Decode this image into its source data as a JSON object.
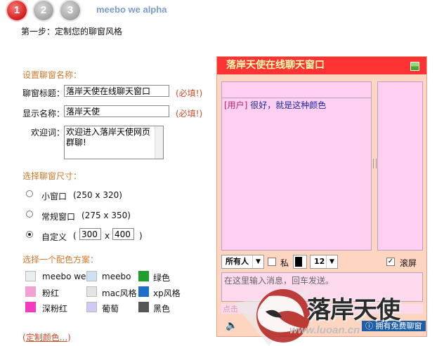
{
  "steps": [
    "1",
    "2",
    "3"
  ],
  "brand": "meebo we alpha",
  "heading": "第一步：定制您的聊窗风格",
  "name_section": {
    "title": "设置聊窗名称：",
    "chat_title_label": "聊窗标题：",
    "chat_title_value": "落岸天使在线聊天窗口",
    "display_name_label": "显示名称：",
    "display_name_value": "落岸天使",
    "welcome_label": "欢迎词：",
    "welcome_value": "欢迎进入落岸天使网页群聊!",
    "required": "(必填!)"
  },
  "size_section": {
    "title": "选择聊窗尺寸：",
    "options": [
      {
        "label": "小窗口",
        "dims": "(250 x 320)",
        "selected": false
      },
      {
        "label": "常规窗口",
        "dims": "(275 x 350)",
        "selected": false
      },
      {
        "label": "自定义",
        "dims": "",
        "selected": true
      }
    ],
    "custom_open": "(",
    "custom_width": "300",
    "custom_x": "x",
    "custom_height": "400",
    "custom_close": ")"
  },
  "color_section": {
    "title": "选择一个配色方案：",
    "schemes": [
      {
        "label": "meebo we",
        "color": "#e9eef0"
      },
      {
        "label": "meebo",
        "color": "#cfe0f4"
      },
      {
        "label": "绿色",
        "color": "#1f9e2c"
      },
      {
        "label": "粉红",
        "color": "#f5a0d2"
      },
      {
        "label": "mac风格",
        "color": "#e3e3e3"
      },
      {
        "label": "xp风格",
        "color": "#1f6fc8"
      },
      {
        "label": "深粉红",
        "color": "#f23bc0"
      },
      {
        "label": "葡萄",
        "color": "#cfc9f3"
      },
      {
        "label": "黑色",
        "color": "#555555"
      }
    ],
    "custom_link_open": "(",
    "custom_link": "定制颜色...",
    "custom_link_close": ")"
  },
  "preview": {
    "title": "落岸天使在线聊天窗口",
    "message_user": "[用户]",
    "message_text": "很好，就是这种颜色",
    "recipient_select": "所有人",
    "private_label": "私",
    "font_size": "12",
    "scroll_label": "滚屏",
    "scroll_checked": true,
    "input_placeholder": "在这里输入消息，回车发送。",
    "footer_left": "点击",
    "footer_link": "拥有免费聊窗"
  },
  "watermark": {
    "text": "落岸天使",
    "url": "www.luoan.cn"
  },
  "colors": {
    "accent_orange": "#d4782c",
    "title_bar": "#ff3333",
    "chat_bg": "#fdd5c1",
    "pane_bg": "#fecff0"
  }
}
